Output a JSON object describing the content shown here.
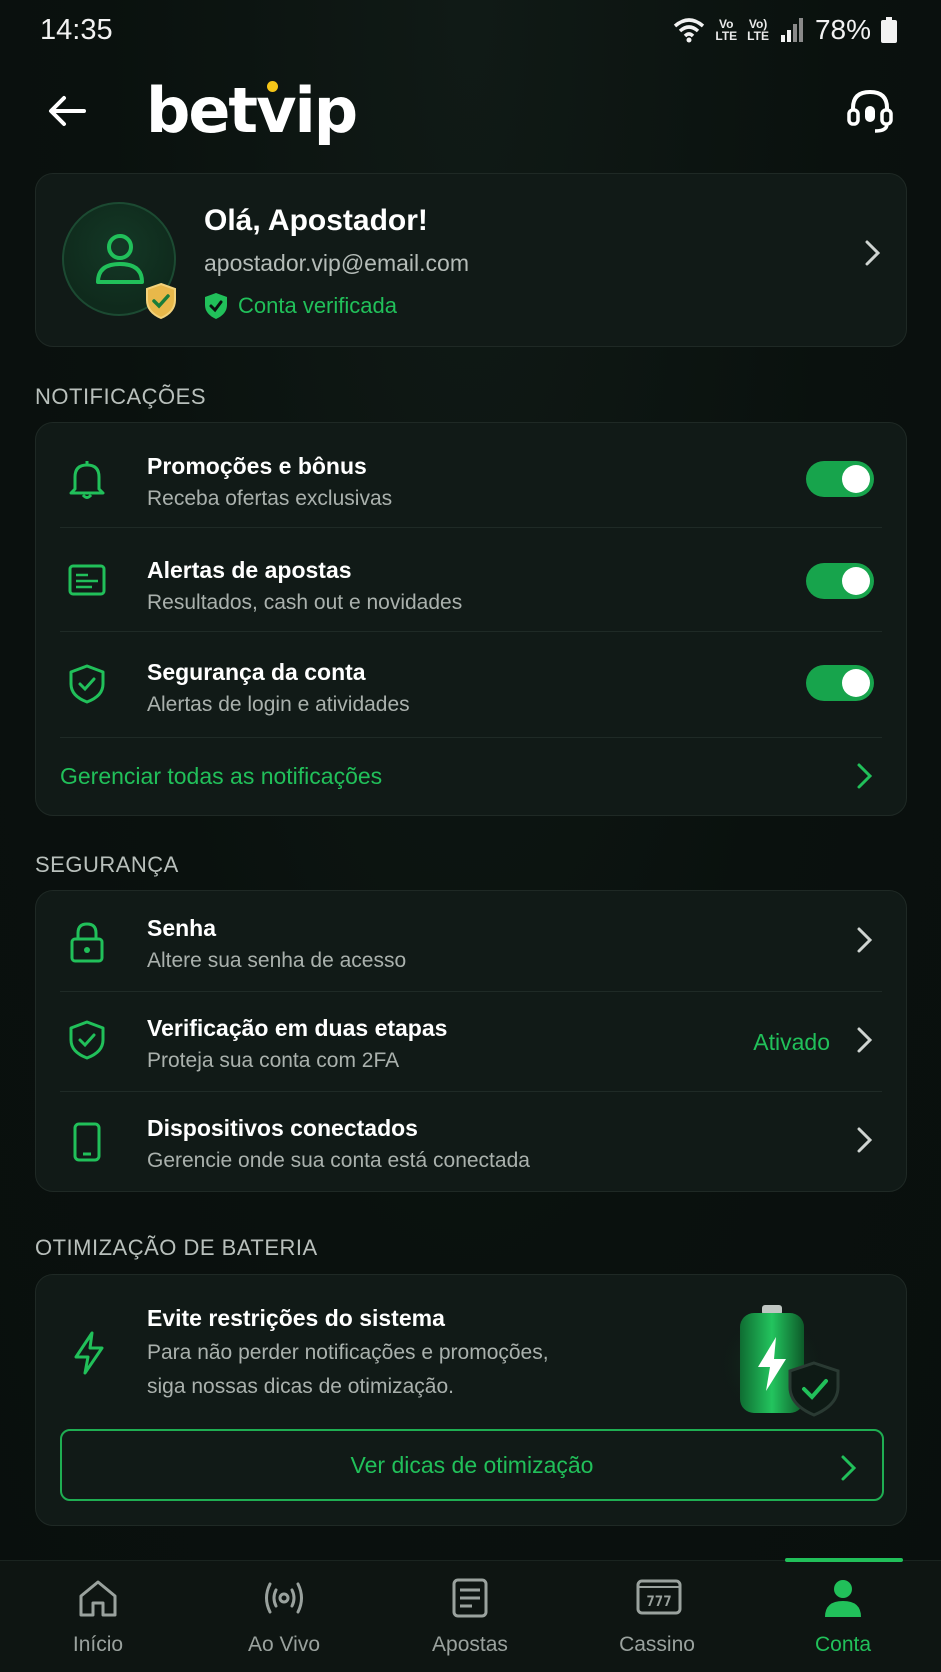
{
  "status_bar": {
    "time": "14:35",
    "battery": "78%",
    "lte1_top": "Vo",
    "lte1_bottom": "LTE",
    "lte2_top": "Vo)",
    "lte2_bottom": "LTE"
  },
  "header": {
    "logo": "betvip"
  },
  "profile": {
    "greeting": "Olá, Apostador!",
    "email": "apostador.vip@email.com",
    "verified": "Conta verificada"
  },
  "notifications": {
    "section_title": "NOTIFICAÇÕES",
    "items": [
      {
        "title": "Promoções e bônus",
        "subtitle": "Receba ofertas exclusivas",
        "enabled": true
      },
      {
        "title": "Alertas de apostas",
        "subtitle": "Resultados, cash out e novidades",
        "enabled": true
      },
      {
        "title": "Segurança da conta",
        "subtitle": "Alertas de login e atividades",
        "enabled": true
      }
    ],
    "manage_link": "Gerenciar todas as notificações"
  },
  "security": {
    "section_title": "SEGURANÇA",
    "items": [
      {
        "title": "Senha",
        "subtitle": "Altere sua senha de acesso",
        "status": ""
      },
      {
        "title": "Verificação em duas etapas",
        "subtitle": "Proteja sua conta com 2FA",
        "status": "Ativado"
      },
      {
        "title": "Dispositivos conectados",
        "subtitle": "Gerencie onde sua conta está conectada",
        "status": ""
      }
    ]
  },
  "battery": {
    "section_title": "OTIMIZAÇÃO DE BATERIA",
    "title": "Evite restrições do sistema",
    "line1": "Para não perder notificações e promoções,",
    "line2": "siga nossas dicas de otimização.",
    "button": "Ver dicas de otimização"
  },
  "bottom_nav": {
    "items": [
      {
        "label": "Início",
        "icon": "home-icon"
      },
      {
        "label": "Ao Vivo",
        "icon": "live-icon"
      },
      {
        "label": "Apostas",
        "icon": "bets-icon"
      },
      {
        "label": "Cassino",
        "icon": "casino-icon"
      },
      {
        "label": "Conta",
        "icon": "account-icon",
        "active": true
      }
    ]
  },
  "colors": {
    "accent": "#21c05a",
    "background": "#0b1210",
    "card": "#111a17"
  }
}
